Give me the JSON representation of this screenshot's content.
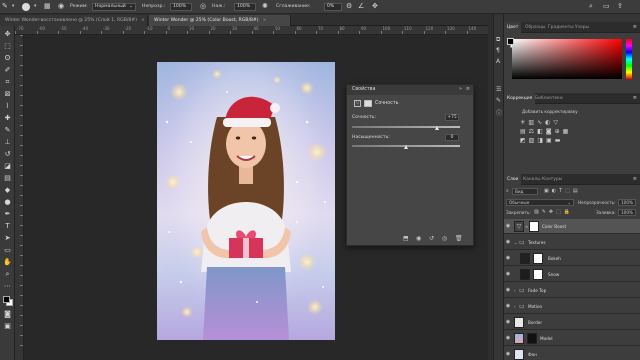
{
  "options_bar": {
    "mode_label": "Режим:",
    "mode_value": "Нормальный",
    "opacity_label": "Непрозр.:",
    "opacity_value": "100%",
    "pressure_label": "Наж.:",
    "pressure_value": "100%",
    "smoothing_label": "Сглаживание:",
    "smoothing_value": "0%"
  },
  "document_tabs": [
    {
      "label": "Winter Wonder-восстановлено @ 25% (Слой 1, RGB/8#)",
      "close": "×"
    },
    {
      "label": "Winter Wonder @ 25% (Color Boost, RGB/8#)",
      "close": "×"
    }
  ],
  "ruler_ticks": [
    "-70",
    "-60",
    "-50",
    "-40",
    "-30",
    "-20",
    "-10",
    "0",
    "10",
    "20",
    "30",
    "40",
    "50",
    "60",
    "70",
    "80",
    "90",
    "100",
    "110",
    "120",
    "130",
    "140"
  ],
  "properties": {
    "title": "Свойства",
    "section": "Сочность",
    "vibrance_label": "Сочность:",
    "vibrance_value": "+75",
    "vibrance_level": 0.79,
    "saturation_label": "Насыщенность:",
    "saturation_value": "0",
    "saturation_level": 0.5
  },
  "color_panel": {
    "tabs": [
      "Цвет",
      "Образцы",
      "Градиенты",
      "Узоры"
    ],
    "hue_color": "#ff0000",
    "fg_color": "#000000",
    "bg_color": "#ffffff"
  },
  "adjustments_panel": {
    "tabs": [
      "Коррекция",
      "Библиотеки"
    ],
    "add_label": "Добавить корректировку"
  },
  "layers_panel": {
    "tabs": [
      "Слои",
      "Каналы",
      "Контуры"
    ],
    "kind_label": "Вид",
    "blend_mode": "Обычные",
    "opacity_label": "Непрозрачность:",
    "opacity_value": "100%",
    "lock_label": "Закрепить:",
    "fill_label": "Заливка:",
    "fill_value": "100%",
    "layers": [
      {
        "name": "Color Boost",
        "selected": true
      },
      {
        "name": "Textures"
      },
      {
        "name": "Bokeh"
      },
      {
        "name": "Snow"
      },
      {
        "name": "Fade Top"
      },
      {
        "name": "Motion"
      },
      {
        "name": "Border"
      },
      {
        "name": "Model"
      },
      {
        "name": "Фон"
      }
    ]
  }
}
